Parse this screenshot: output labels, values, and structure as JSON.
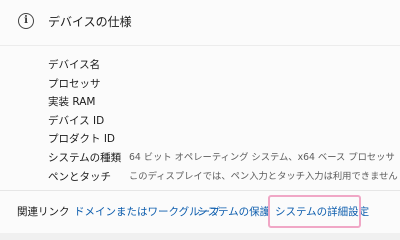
{
  "header": {
    "title": "デバイスの仕様",
    "icon": "info-icon",
    "icon_glyph": "i"
  },
  "specs": [
    {
      "label": "デバイス名",
      "value": ""
    },
    {
      "label": "プロセッサ",
      "value": ""
    },
    {
      "label": "実装 RAM",
      "value": ""
    },
    {
      "label": "デバイス ID",
      "value": ""
    },
    {
      "label": "プロダクト ID",
      "value": ""
    },
    {
      "label": "システムの種類",
      "value": "64 ビット オペレーティング システム、x64 ベース プロセッサ"
    },
    {
      "label": "ペンとタッチ",
      "value": "このディスプレイでは、ペン入力とタッチ入力は利用できません"
    }
  ],
  "related": {
    "label": "関連リンク",
    "links": [
      "ドメインまたはワークグループ",
      "システムの保護",
      "システムの詳細設定"
    ]
  },
  "colors": {
    "link": "#0b5cad",
    "highlight": "#f0a7c6"
  }
}
